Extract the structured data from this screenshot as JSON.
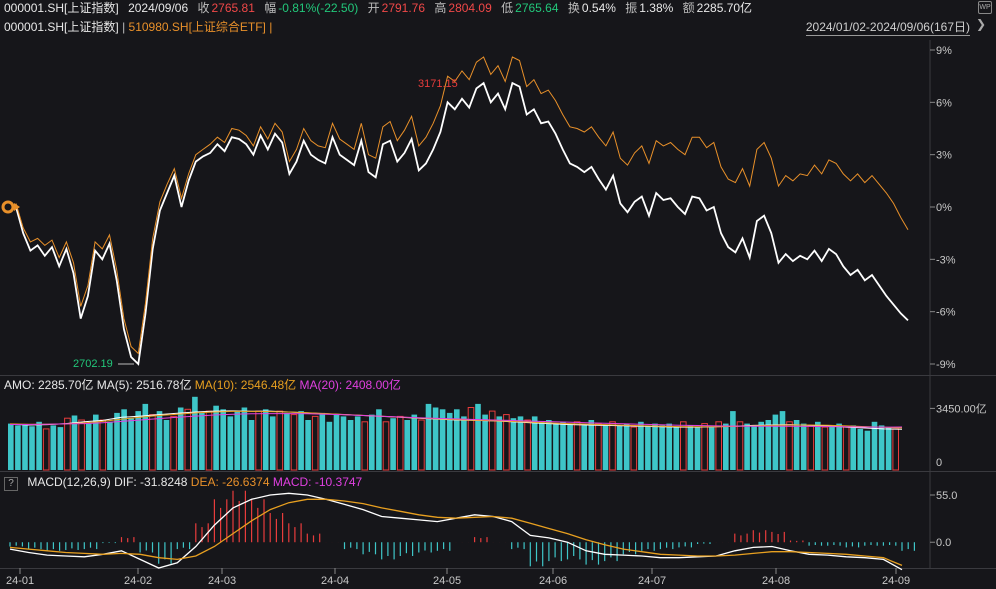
{
  "header": {
    "code": "000001.SH[上证指数]",
    "date": "2024/09/06",
    "close_label": "收",
    "close": "2765.81",
    "change_label": "幅",
    "change": "-0.81%(-22.50)",
    "open_label": "开",
    "open": "2791.76",
    "high_label": "高",
    "high": "2804.09",
    "low_label": "低",
    "low": "2765.64",
    "turnover_label": "换",
    "turnover": "0.54%",
    "amplitude_label": "振",
    "amplitude": "1.38%",
    "amount_label": "额",
    "amount": "2285.70亿",
    "compare_series_1": "000001.SH[上证指数]",
    "compare_series_2": "510980.SH[上证综合ETF]",
    "range": "2024/01/02-2024/09/06(167日)"
  },
  "volume_panel": {
    "title": "AMO: 2285.70亿",
    "ma5": "MA(5): 2516.78亿",
    "ma10": "MA(10): 2546.48亿",
    "ma20": "MA(20): 2408.00亿",
    "axis_top": "3450.00亿",
    "axis_zero": "0"
  },
  "macd_panel": {
    "help": "?",
    "title": "MACD(12,26,9)",
    "dif": "DIF: -31.8248",
    "dea": "DEA: -26.6374",
    "macd": "MACD: -10.3747",
    "axis_top": "55.0",
    "axis_zero": "0.0"
  },
  "colors": {
    "index_line": "#ffffff",
    "etf_line": "#e8902a",
    "up": "#e83c3c",
    "down": "#3ec6c8",
    "ma5": "#ffffff",
    "ma10": "#e8a020",
    "ma20": "#e040e0",
    "bg": "#16161a",
    "grid": "#3a3a3f"
  },
  "chart_data": [
    {
      "type": "line",
      "x_ticks": [
        "24-01",
        "24-02",
        "24-03",
        "24-04",
        "24-05",
        "24-06",
        "24-07",
        "24-08",
        "24-09"
      ],
      "y_ticks": [
        "9%",
        "6%",
        "3%",
        "0%",
        "-3%",
        "-6%",
        "-9%"
      ],
      "ylim": [
        -9,
        9
      ],
      "annotations": [
        {
          "text": "3171.15",
          "x": "24-05"
        },
        {
          "text": "2702.19",
          "x": "24-02"
        }
      ],
      "series": [
        {
          "name": "000001.SH[上证指数]",
          "values": [
            0,
            -1.5,
            -2.5,
            -2.2,
            -2.8,
            -2.3,
            -3.4,
            -2.4,
            -3.8,
            -6.4,
            -5.1,
            -2.5,
            -3.0,
            -2.1,
            -4.2,
            -7.0,
            -8.6,
            -9.0,
            -6.1,
            -2.4,
            -0.2,
            0.8,
            1.8,
            0.0,
            1.5,
            2.6,
            2.9,
            3.1,
            3.6,
            3.2,
            4.0,
            3.9,
            3.6,
            3.0,
            4.1,
            3.3,
            4.2,
            3.7,
            1.9,
            2.6,
            3.8,
            3.0,
            2.7,
            2.5,
            4.0,
            3.0,
            2.7,
            2.4,
            3.8,
            2.0,
            1.7,
            3.6,
            3.8,
            2.6,
            3.1,
            3.9,
            2.1,
            2.5,
            3.3,
            4.3,
            6.0,
            5.6,
            6.2,
            5.7,
            6.8,
            7.1,
            6.0,
            6.5,
            5.6,
            7.1,
            6.9,
            5.3,
            5.6,
            4.8,
            4.9,
            4.2,
            3.3,
            2.5,
            2.3,
            2.0,
            2.3,
            1.6,
            1.0,
            1.8,
            0.2,
            -0.3,
            0.3,
            0.6,
            -0.5,
            0.8,
            0.4,
            0.5,
            0.0,
            -0.4,
            0.6,
            0.5,
            -0.2,
            0.0,
            -1.5,
            -2.3,
            -2.6,
            -1.8,
            -2.9,
            -0.8,
            -0.5,
            -1.5,
            -3.2,
            -2.7,
            -3.1,
            -2.8,
            -3.0,
            -2.5,
            -3.1,
            -2.4,
            -2.7,
            -3.4,
            -3.9,
            -3.6,
            -4.2,
            -3.9,
            -4.5,
            -5.1,
            -5.6,
            -6.1,
            -6.5
          ]
        },
        {
          "name": "510980.SH[上证综合ETF]",
          "values": [
            0.2,
            -1.2,
            -2.0,
            -1.8,
            -2.2,
            -1.9,
            -2.9,
            -2.0,
            -3.2,
            -5.7,
            -4.5,
            -2.0,
            -2.4,
            -1.6,
            -3.6,
            -6.4,
            -8.0,
            -8.4,
            -5.5,
            -1.8,
            0.3,
            1.3,
            2.2,
            0.5,
            1.9,
            3.0,
            3.3,
            3.6,
            4.0,
            3.7,
            4.5,
            4.4,
            4.1,
            3.5,
            4.6,
            3.9,
            4.8,
            4.3,
            2.6,
            3.3,
            4.5,
            3.8,
            3.5,
            3.4,
            4.8,
            3.9,
            3.6,
            3.3,
            4.8,
            3.0,
            2.8,
            4.6,
            4.9,
            3.8,
            4.4,
            5.2,
            3.5,
            4.0,
            4.8,
            5.8,
            7.5,
            7.2,
            7.8,
            7.3,
            8.3,
            8.6,
            7.6,
            8.1,
            7.2,
            8.6,
            8.4,
            6.9,
            7.3,
            6.5,
            6.7,
            6.1,
            5.3,
            4.6,
            4.5,
            4.3,
            4.6,
            4.0,
            3.5,
            4.3,
            2.8,
            2.4,
            3.1,
            3.5,
            2.5,
            3.8,
            3.5,
            3.7,
            3.3,
            3.0,
            4.0,
            4.0,
            3.4,
            3.7,
            2.3,
            1.6,
            1.4,
            2.2,
            1.2,
            3.3,
            3.7,
            2.8,
            1.2,
            1.8,
            1.5,
            1.9,
            1.8,
            2.4,
            1.9,
            2.7,
            2.5,
            1.9,
            1.5,
            1.9,
            1.4,
            1.8,
            1.3,
            0.8,
            0.2,
            -0.6,
            -1.3
          ]
        }
      ]
    },
    {
      "type": "bar",
      "title": "AMO",
      "ylim": [
        0,
        3450
      ],
      "values": [
        2600,
        2500,
        2550,
        2450,
        2700,
        2300,
        2500,
        2400,
        2900,
        3050,
        2800,
        2600,
        3100,
        2800,
        2700,
        3200,
        3400,
        2900,
        3300,
        3700,
        3100,
        3300,
        2800,
        3000,
        3500,
        3400,
        4100,
        3200,
        3300,
        3600,
        3400,
        3000,
        3300,
        3500,
        2800,
        3300,
        3400,
        3000,
        3300,
        3200,
        3100,
        3300,
        2800,
        3000,
        3200,
        2700,
        3100,
        3000,
        2800,
        3000,
        2700,
        3100,
        3400,
        2700,
        2900,
        3000,
        2800,
        3100,
        2800,
        3700,
        3500,
        3400,
        3200,
        3400,
        3000,
        3500,
        3700,
        3100,
        3300,
        3000,
        3100,
        2900,
        3000,
        2800,
        3000,
        2700,
        2800,
        2600,
        2700,
        2600,
        2700,
        2500,
        2800,
        2600,
        2500,
        2700,
        2500,
        2600,
        2400,
        2700,
        2500,
        2600,
        2500,
        2600,
        2400,
        2700,
        2500,
        2400,
        2600,
        2400,
        2700,
        2600,
        3300,
        2700,
        2600,
        2500,
        2700,
        2800,
        3100,
        3300,
        2700,
        2800,
        2600,
        2500,
        2700,
        2400,
        2500,
        2600,
        2400,
        2500,
        2300,
        2200,
        2700,
        2500,
        2400,
        2300
      ],
      "series": [
        {
          "name": "MA(5)",
          "values": [
            2560,
            2520,
            2540,
            2600,
            2700,
            2780,
            2950,
            3020,
            3100,
            3180,
            3250,
            3300,
            3310,
            3290,
            3300,
            3250,
            3200,
            3150,
            3100,
            3050,
            3000,
            2950,
            2900,
            2850,
            2800,
            2780,
            2750,
            2700,
            2650,
            2600,
            2550,
            2520,
            2500,
            2480,
            2450,
            2420,
            2400,
            2400,
            2420,
            2450,
            2500,
            2520,
            2540,
            2500,
            2480,
            2400,
            2350,
            2300,
            2280
          ]
        },
        {
          "name": "MA(10)",
          "values": [
            2580,
            2560,
            2560,
            2580,
            2640,
            2720,
            2850,
            2950,
            3050,
            3120,
            3200,
            3250,
            3280,
            3280,
            3270,
            3250,
            3210,
            3160,
            3110,
            3060,
            3010,
            2960,
            2910,
            2860,
            2820,
            2790,
            2760,
            2720,
            2680,
            2640,
            2600,
            2570,
            2540,
            2510,
            2480,
            2450,
            2430,
            2420,
            2420,
            2440,
            2470,
            2500,
            2520,
            2520,
            2510,
            2470,
            2430,
            2390,
            2360
          ]
        },
        {
          "name": "MA(20)",
          "values": [
            2550,
            2550,
            2560,
            2580,
            2600,
            2650,
            2720,
            2800,
            2880,
            2950,
            3020,
            3080,
            3120,
            3150,
            3160,
            3160,
            3150,
            3120,
            3090,
            3050,
            3010,
            2970,
            2930,
            2890,
            2860,
            2830,
            2800,
            2770,
            2740,
            2710,
            2680,
            2650,
            2620,
            2590,
            2560,
            2530,
            2510,
            2490,
            2470,
            2460,
            2450,
            2450,
            2450,
            2440,
            2430,
            2420,
            2410,
            2405,
            2408
          ]
        }
      ]
    },
    {
      "type": "bar",
      "title": "MACD(12,26,9)",
      "ylim": [
        -30,
        55
      ],
      "series": [
        {
          "name": "DIF",
          "values": [
            -8,
            -12,
            -15,
            -16,
            -17,
            -14,
            -10,
            -20,
            -30,
            -24,
            -5,
            20,
            40,
            50,
            55,
            57,
            55,
            50,
            44,
            38,
            30,
            28,
            26,
            24,
            28,
            32,
            30,
            24,
            8,
            5,
            0,
            -10,
            -14,
            -15,
            -16,
            -18,
            -18,
            -17,
            -16,
            -10,
            -6,
            -5,
            -10,
            -14,
            -15,
            -17,
            -18,
            -20,
            -32
          ]
        },
        {
          "name": "DEA",
          "values": [
            -6,
            -8,
            -10,
            -12,
            -13,
            -14,
            -13,
            -14,
            -18,
            -20,
            -16,
            -5,
            10,
            25,
            38,
            46,
            50,
            50,
            48,
            45,
            40,
            36,
            32,
            29,
            28,
            29,
            30,
            28,
            22,
            16,
            10,
            3,
            -3,
            -8,
            -11,
            -14,
            -15,
            -16,
            -16,
            -15,
            -13,
            -11,
            -11,
            -12,
            -13,
            -14,
            -16,
            -18,
            -27
          ]
        },
        {
          "name": "MACD",
          "values": [
            -5,
            -8,
            -10,
            -9,
            -8,
            -1,
            6,
            -12,
            -25,
            -8,
            22,
            50,
            60,
            50,
            34,
            22,
            10,
            0,
            -8,
            -14,
            -20,
            -16,
            -12,
            -10,
            0,
            6,
            0,
            -8,
            -28,
            -22,
            -20,
            -26,
            -22,
            -14,
            -10,
            -8,
            -6,
            -2,
            0,
            10,
            14,
            12,
            2,
            -4,
            -4,
            -6,
            -4,
            -4,
            -10
          ]
        }
      ]
    }
  ]
}
